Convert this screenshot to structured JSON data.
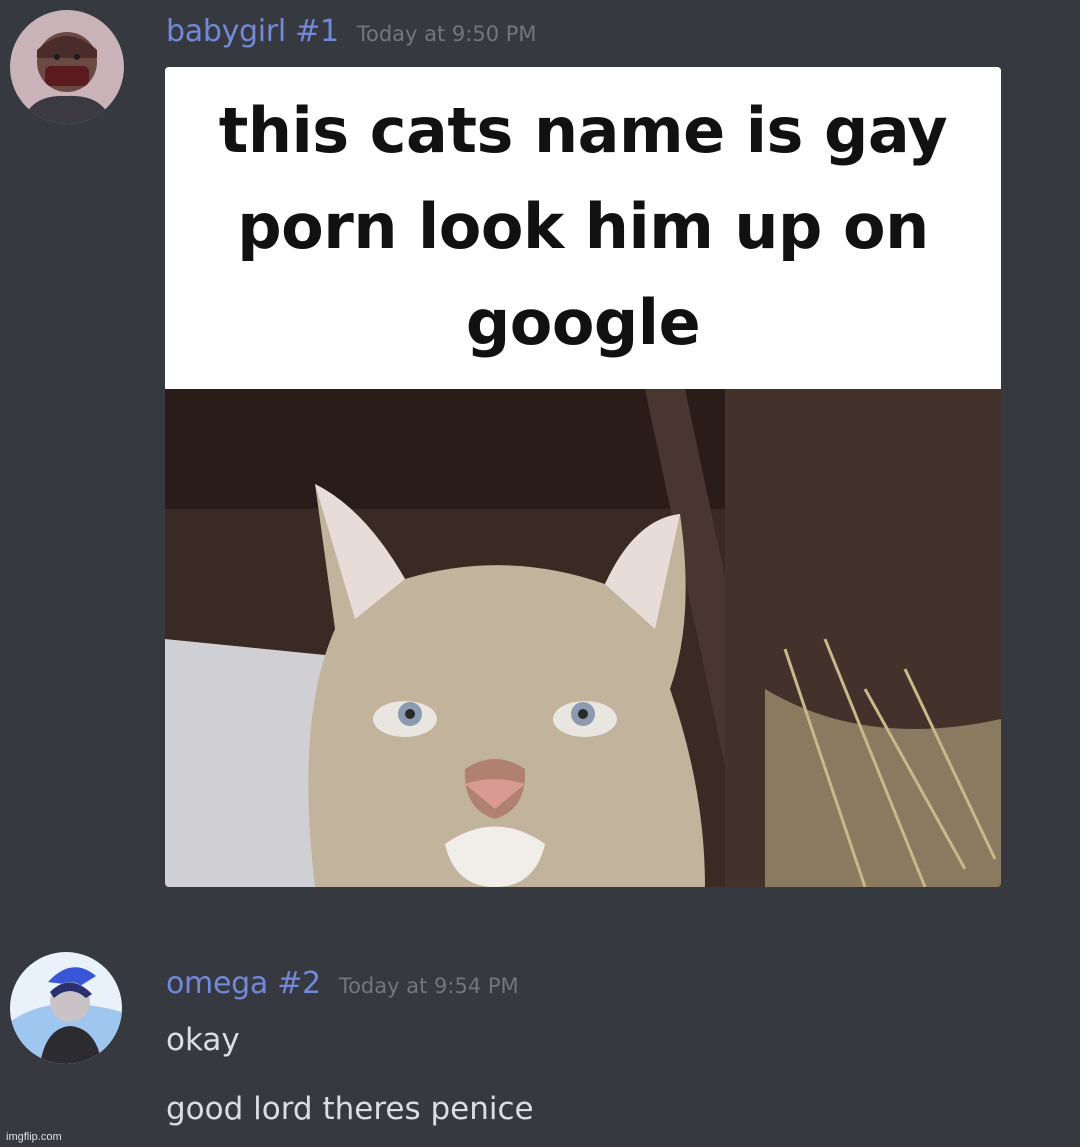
{
  "messages": [
    {
      "username": "babygirl #1",
      "timestamp": "Today at 9:50 PM",
      "attachment": {
        "caption": "this cats name is gay porn look him up on google"
      }
    },
    {
      "username": "omega #2",
      "timestamp": "Today at 9:54 PM",
      "lines": [
        "okay",
        "good lord theres penice"
      ]
    }
  ],
  "watermark": "imgflip.com",
  "colors": {
    "background": "#36393f",
    "username": "#7289da",
    "timestamp": "#72767d",
    "message_text": "#dcddde"
  }
}
